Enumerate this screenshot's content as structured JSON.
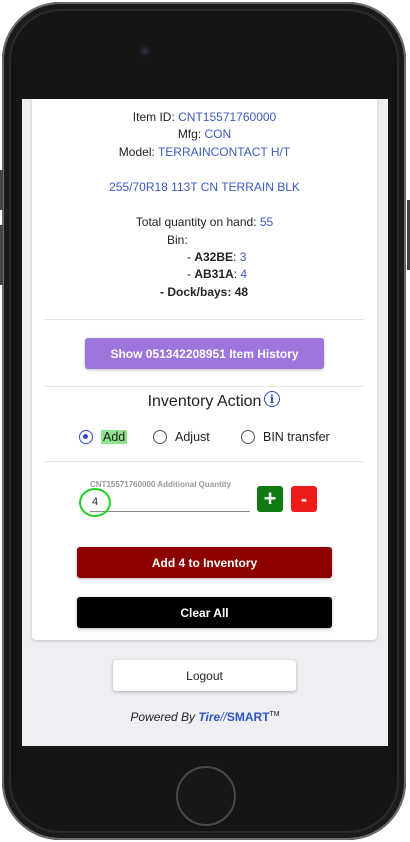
{
  "item": {
    "id_label": "Item ID:",
    "id_value": "CNT15571760000",
    "mfg_label": "Mfg:",
    "mfg_value": "CON",
    "model_label": "Model:",
    "model_value": "TERRAINCONTACT H/T",
    "description": "255/70R18 113T CN TERRAIN BLK",
    "total_qty_label": "Total quantity on hand:",
    "total_qty_value": "55",
    "bin_label": "Bin:",
    "bins": [
      {
        "name": "A32BE",
        "qty": "3"
      },
      {
        "name": "AB31A",
        "qty": "4"
      }
    ],
    "dock_label": "- Dock/bays: 48"
  },
  "history_button": "Show 051342208951 Item History",
  "inventory_action": {
    "title": "Inventory Action",
    "info_icon": "info-icon",
    "options": [
      {
        "label": "Add",
        "selected": true
      },
      {
        "label": "Adjust",
        "selected": false
      },
      {
        "label": "BIN transfer",
        "selected": false
      }
    ]
  },
  "quantity": {
    "label": "CNT15571760000 Additional Quantity",
    "value": "4",
    "plus": "+",
    "minus": "-"
  },
  "add_button": "Add 4 to Inventory",
  "clear_button": "Clear All",
  "logout_button": "Logout",
  "footer": {
    "powered_by": "Powered By",
    "brand_tire": "Tire",
    "brand_slash": "//",
    "brand_smart": "SMART",
    "brand_tm": "TM"
  },
  "colors": {
    "accent_blue": "#3d5ac4",
    "history_purple": "#9c75dd",
    "add_darkred": "#8c0000",
    "plus_green": "#0f7a0f",
    "minus_red": "#ee1b1b",
    "highlight_green": "#8ee28e"
  }
}
